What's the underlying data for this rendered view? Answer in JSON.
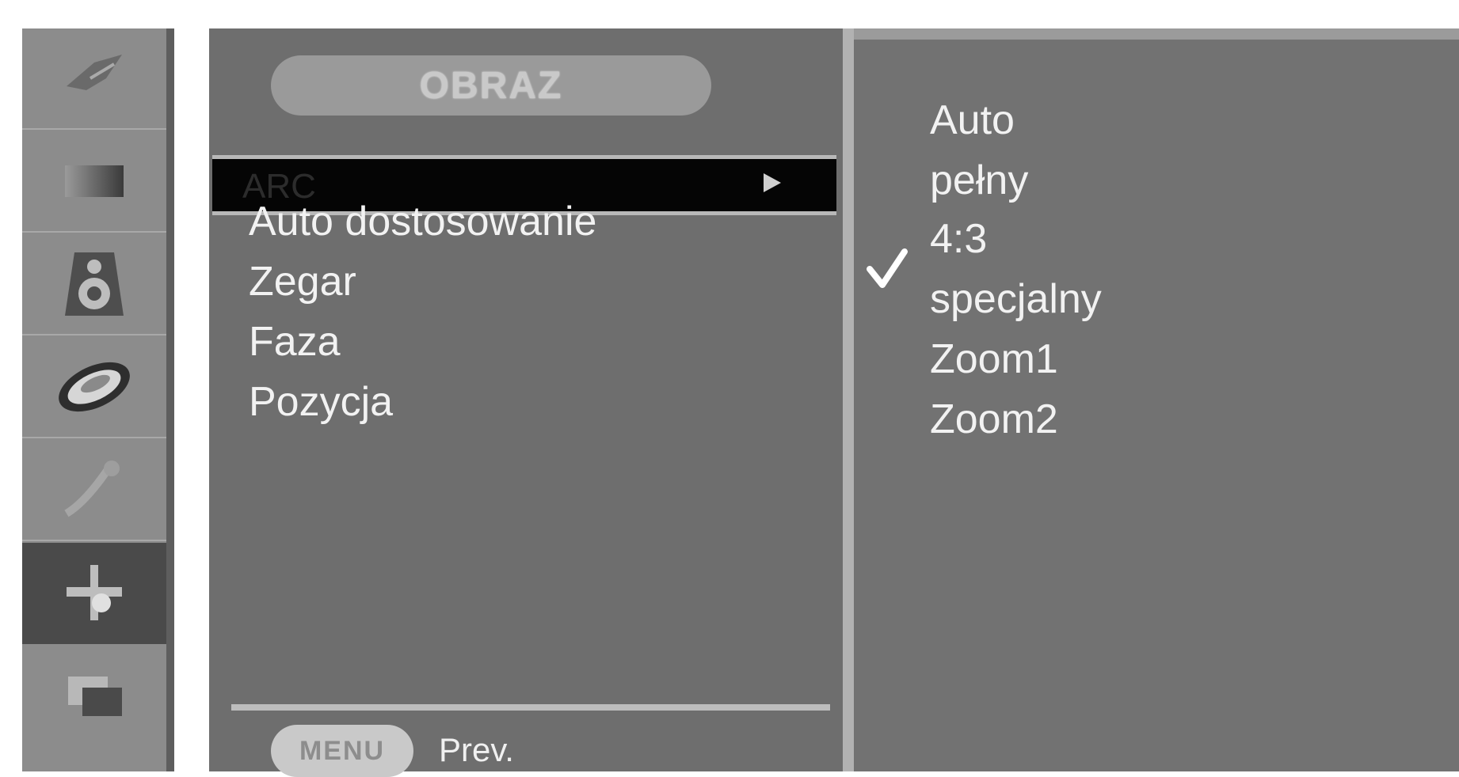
{
  "menu": {
    "title": "OBRAZ",
    "selected_item": "ARC",
    "items": [
      "Auto dostosowanie",
      "Zegar",
      "Faza",
      "Pozycja"
    ],
    "footer": {
      "button_label": "MENU",
      "prev_label": "Prev."
    }
  },
  "options": {
    "items": [
      "Auto",
      "pełny",
      "4:3",
      "specjalny",
      "Zoom1",
      "Zoom2"
    ],
    "checked": "4:3"
  },
  "icons": [
    "station-icon",
    "picture-icon",
    "sound-icon",
    "time-icon",
    "special-icon",
    "screen-icon",
    "pip-icon"
  ],
  "colors": {
    "panel": "#6e6e6e",
    "selection": "#050505",
    "text": "#f2f2f2"
  }
}
